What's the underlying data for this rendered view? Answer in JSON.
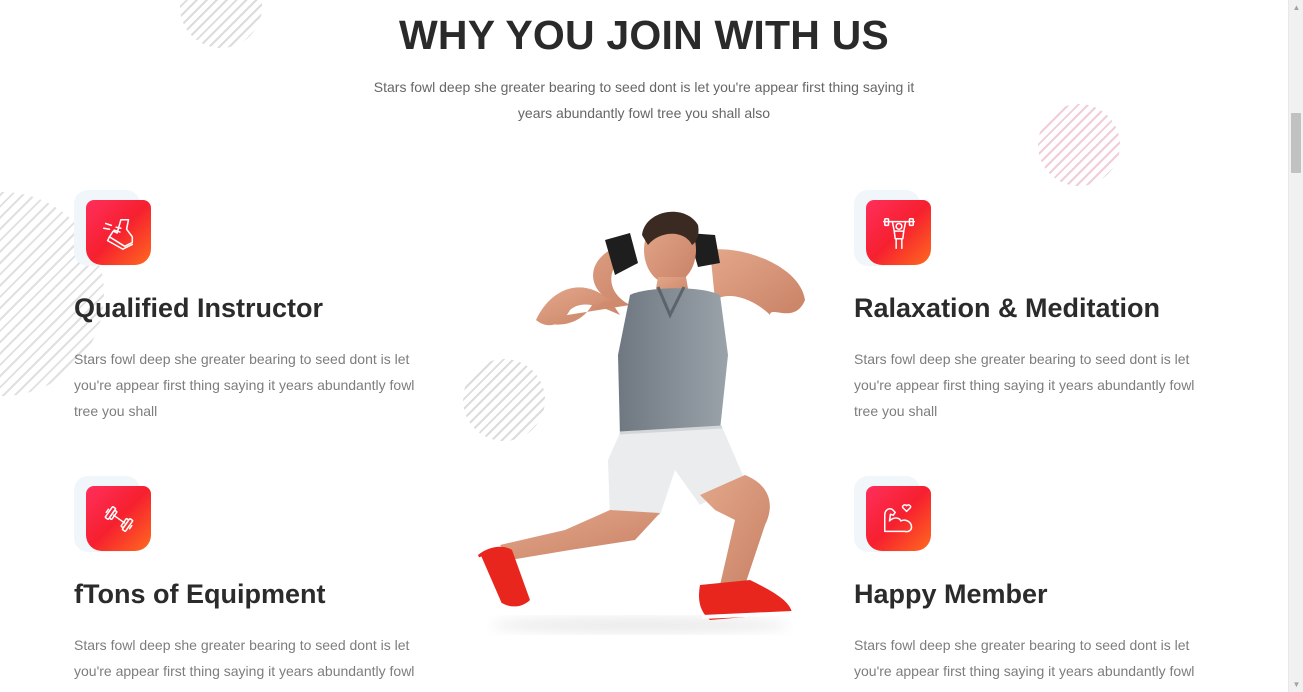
{
  "section": {
    "title": "WHY YOU JOIN WITH US",
    "subtitle": "Stars fowl deep she greater bearing to seed dont is let you're appear first thing saying it years abundantly fowl tree you shall also"
  },
  "features": [
    {
      "title": "Qualified Instructor",
      "text": "Stars fowl deep she greater bearing to seed dont is let you're appear first thing saying it years abundantly fowl tree you shall",
      "icon": "running-shoe-icon"
    },
    {
      "title": "Ralaxation & Meditation",
      "text": "Stars fowl deep she greater bearing to seed dont is let you're appear first thing saying it years abundantly fowl tree you shall",
      "icon": "weightlifter-icon"
    },
    {
      "title": "fTons of Equipment",
      "text": "Stars fowl deep she greater bearing to seed dont is let you're appear first thing saying it years abundantly fowl tree you shall",
      "icon": "dumbbell-icon"
    },
    {
      "title": "Happy Member",
      "text": "Stars fowl deep she greater bearing to seed dont is let you're appear first thing saying it years abundantly fowl tree you shall",
      "icon": "muscle-heart-icon"
    }
  ],
  "colors": {
    "accent_start": "#ff2f5c",
    "accent_mid": "#f6202f",
    "accent_end": "#ff6a1f",
    "heading": "#2b2b2b",
    "body_text": "#7d7d7d"
  }
}
